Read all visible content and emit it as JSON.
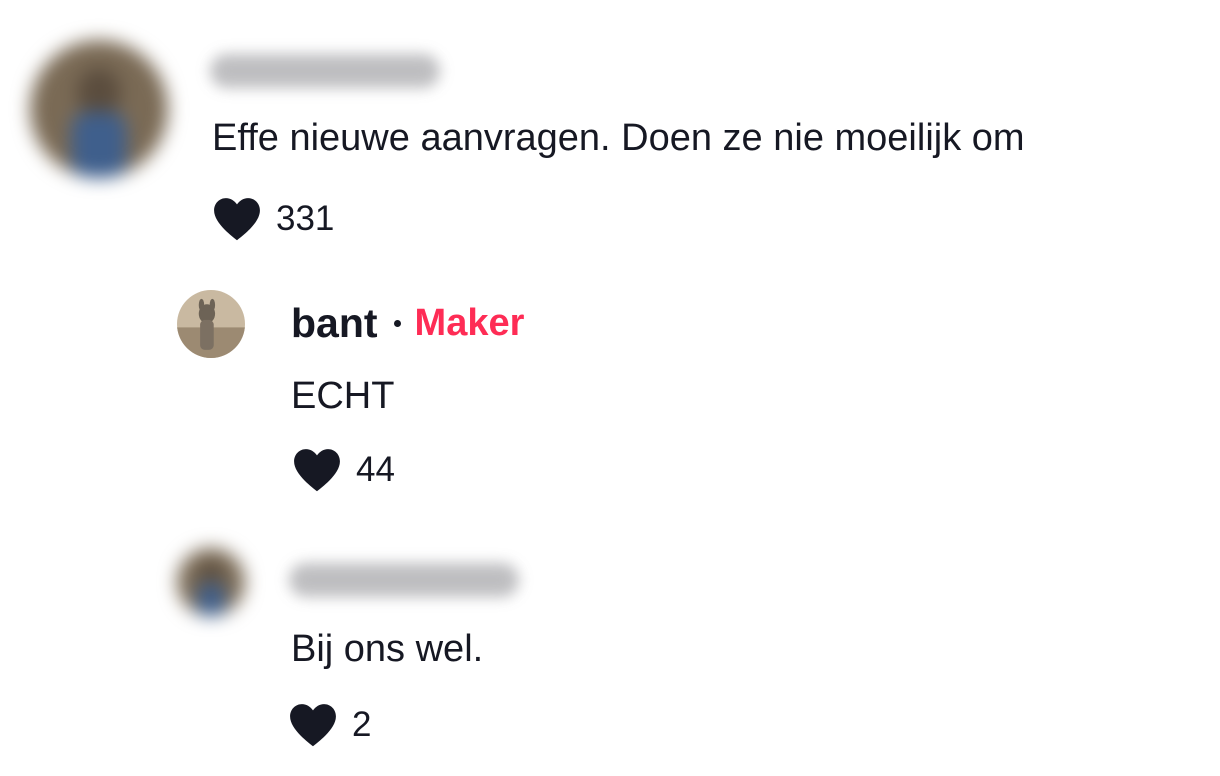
{
  "comments": [
    {
      "author_name_visible": false,
      "text": "Effe nieuwe aanvragen. Doen ze nie moeilijk om",
      "likes": "331"
    },
    {
      "author_name": "bant",
      "badge": "Maker",
      "text": "ECHT",
      "likes": "44"
    },
    {
      "author_name_visible": false,
      "text": "Bij ons wel.",
      "likes": "2"
    }
  ],
  "colors": {
    "text": "#161823",
    "badge": "#fe2c55",
    "like_icon": "#161823"
  },
  "icons": {
    "like": "heart-icon"
  }
}
